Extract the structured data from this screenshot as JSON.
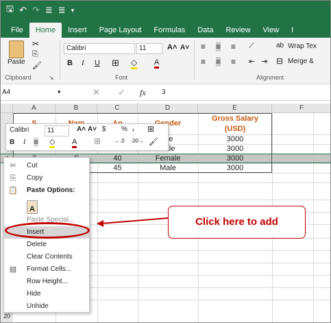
{
  "titlebar": {
    "icons": [
      "save-icon",
      "undo-icon",
      "redo-icon",
      "format-icon",
      "format2-icon",
      "more-icon"
    ]
  },
  "tabs": [
    {
      "label": "File",
      "active": false
    },
    {
      "label": "Home",
      "active": true
    },
    {
      "label": "Insert",
      "active": false
    },
    {
      "label": "Page Layout",
      "active": false
    },
    {
      "label": "Formulas",
      "active": false
    },
    {
      "label": "Data",
      "active": false
    },
    {
      "label": "Review",
      "active": false
    },
    {
      "label": "View",
      "active": false
    },
    {
      "label": "I",
      "active": false
    }
  ],
  "ribbon": {
    "paste_label": "Paste",
    "clipboard_label": "Clipboard",
    "font_name": "Calibri",
    "font_size": "11",
    "font_group_label": "Font",
    "alignment_label": "Alignment",
    "wrap_text": "Wrap Tex",
    "merge": "Merge &"
  },
  "formula_bar": {
    "cell_ref": "A4",
    "fx_label": "fx",
    "value": "3"
  },
  "columns": [
    "A",
    "B",
    "C",
    "D",
    "E",
    "F"
  ],
  "headers": {
    "a": "S",
    "b": "Nam",
    "c": "Ag",
    "d": "Gender",
    "e_line1": "Gross Salary",
    "e_line2": "(USD)"
  },
  "rows": [
    {
      "num": "",
      "a": "",
      "b": "",
      "c": "",
      "d": "ale",
      "e": "3000"
    },
    {
      "num": "",
      "a": "",
      "b": "",
      "c": "",
      "d": "nale",
      "e": "3000"
    },
    {
      "num": "4",
      "a": "3",
      "b": "C",
      "c": "40",
      "d": "Female",
      "e": "3000"
    },
    {
      "num": "",
      "a": "",
      "b": "",
      "c": "45",
      "d": "Male",
      "e": "3000"
    }
  ],
  "last_row_num": "20",
  "mini_toolbar": {
    "font": "Calibri",
    "size": "11",
    "currency": "$",
    "percent": "%",
    "comma": ","
  },
  "context_menu": [
    {
      "label": "Cut",
      "icon": "scissors-icon",
      "disabled": false
    },
    {
      "label": "Copy",
      "icon": "copy-icon",
      "disabled": false
    },
    {
      "label": "Paste Options:",
      "icon": "paste-icon",
      "disabled": false,
      "bold": true
    },
    {
      "label": "",
      "icon": "paste-a-icon",
      "disabled": false
    },
    {
      "label": "Paste Special...",
      "icon": "",
      "disabled": true
    },
    {
      "label": "Insert",
      "icon": "",
      "disabled": false
    },
    {
      "label": "Delete",
      "icon": "",
      "disabled": false
    },
    {
      "label": "Clear Contents",
      "icon": "",
      "disabled": false
    },
    {
      "label": "Format Cells...",
      "icon": "format-cells-icon",
      "disabled": false
    },
    {
      "label": "Row Height...",
      "icon": "",
      "disabled": false
    },
    {
      "label": "Hide",
      "icon": "",
      "disabled": false
    },
    {
      "label": "Unhide",
      "icon": "",
      "disabled": false
    }
  ],
  "callout": {
    "text": "Click here to add"
  },
  "colors": {
    "excel_green": "#217346",
    "header_orange": "#c55a11",
    "callout_red": "#c00000"
  }
}
